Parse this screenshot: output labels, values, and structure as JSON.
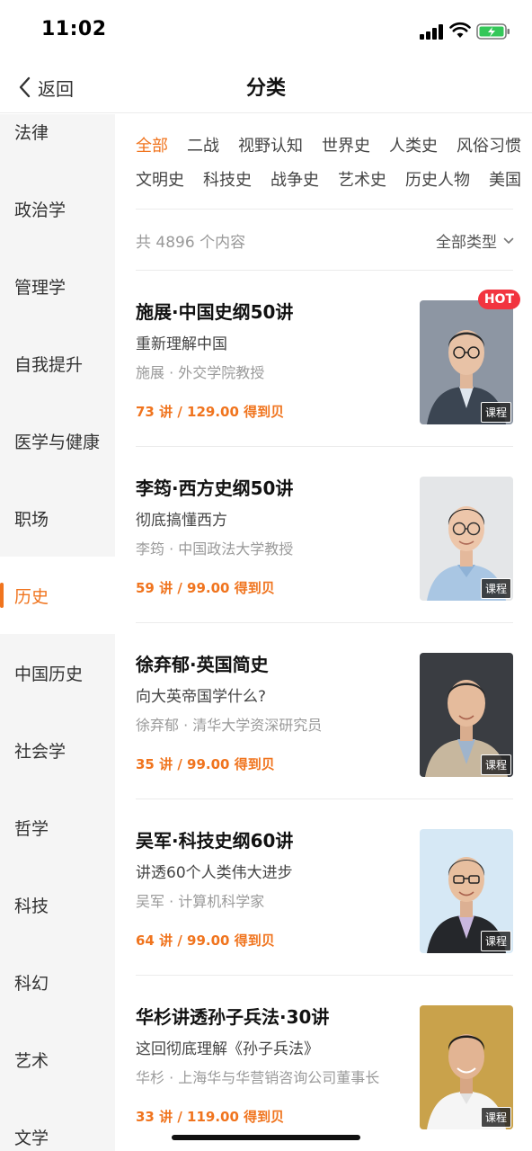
{
  "status_bar": {
    "time": "11:02"
  },
  "nav": {
    "back_label": "返回",
    "title": "分类"
  },
  "sidebar": {
    "items": [
      {
        "label": "法律"
      },
      {
        "label": "政治学"
      },
      {
        "label": "管理学"
      },
      {
        "label": "自我提升"
      },
      {
        "label": "医学与健康"
      },
      {
        "label": "职场"
      },
      {
        "label": "历史",
        "active": true
      },
      {
        "label": "中国历史"
      },
      {
        "label": "社会学"
      },
      {
        "label": "哲学"
      },
      {
        "label": "科技"
      },
      {
        "label": "科幻"
      },
      {
        "label": "艺术"
      },
      {
        "label": "文学"
      }
    ]
  },
  "tags": {
    "row1": [
      "全部",
      "二战",
      "视野认知",
      "世界史",
      "人类史",
      "风俗习惯"
    ],
    "row2": [
      "文明史",
      "科技史",
      "战争史",
      "艺术史",
      "历史人物",
      "美国"
    ]
  },
  "summary": {
    "count_text": "共 4896 个内容",
    "type_filter": "全部类型"
  },
  "courses": [
    {
      "title": "施展·中国史纲50讲",
      "subtitle": "重新理解中国",
      "author": "施展 · 外交学院教授",
      "price": "73 讲 / 129.00 得到贝",
      "tag": "课程",
      "badge": "HOT",
      "bg": "#8d96a3",
      "suit": "#3b4552",
      "shirt": "#dfe6ee"
    },
    {
      "title": "李筠·西方史纲50讲",
      "subtitle": "彻底搞懂西方",
      "author": "李筠 · 中国政法大学教授",
      "price": "59 讲 / 99.00 得到贝",
      "tag": "课程",
      "bg": "#e4e6e8",
      "suit": "#a9c6e3",
      "shirt": "#a9c6e3"
    },
    {
      "title": "徐弃郁·英国简史",
      "subtitle": "向大英帝国学什么?",
      "author": "徐弃郁 · 清华大学资深研究员",
      "price": "35 讲 / 99.00 得到贝",
      "tag": "课程",
      "bg": "#3a3d42",
      "suit": "#c7b79e",
      "shirt": "#9fb4cc"
    },
    {
      "title": "吴军·科技史纲60讲",
      "subtitle": "讲透60个人类伟大进步",
      "author": "吴军 · 计算机科学家",
      "price": "64 讲 / 99.00 得到贝",
      "tag": "课程",
      "bg": "#d6e8f5",
      "suit": "#25272b",
      "shirt": "#c9b7de"
    },
    {
      "title": "华杉讲透孙子兵法·30讲",
      "subtitle": "这回彻底理解《孙子兵法》",
      "author": "华杉 · 上海华与华营销咨询公司董事长",
      "price": "33 讲 / 119.00 得到贝",
      "tag": "课程",
      "bg": "#c9a24b",
      "suit": "#f5f5f5",
      "shirt": "#f5f5f5"
    }
  ],
  "colors": {
    "accent": "#f0741e",
    "hot": "#f2343f",
    "sidebar_bg": "#f5f5f5"
  }
}
